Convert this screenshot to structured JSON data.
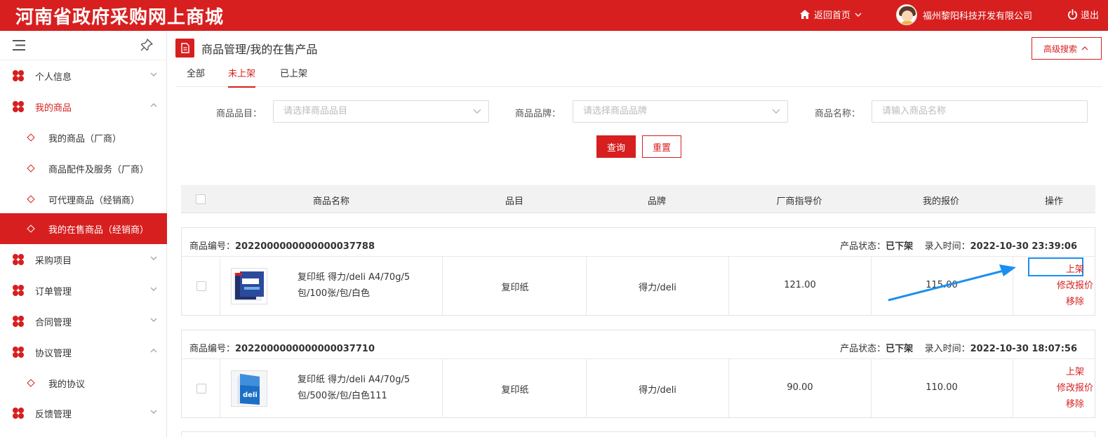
{
  "header": {
    "brand": "河南省政府采购网上商城",
    "home_label": "返回首页",
    "company": "福州黎阳科技开发有限公司",
    "logout_label": "退出"
  },
  "sidebar": {
    "items": [
      {
        "label": "个人信息",
        "type": "group"
      },
      {
        "label": "我的商品",
        "type": "group",
        "open": true
      },
      {
        "label": "我的商品（厂商）",
        "type": "sub"
      },
      {
        "label": "商品配件及服务（厂商）",
        "type": "sub"
      },
      {
        "label": "可代理商品（经销商）",
        "type": "sub"
      },
      {
        "label": "我的在售商品（经销商）",
        "type": "sub",
        "active": true
      },
      {
        "label": "采购项目",
        "type": "group"
      },
      {
        "label": "订单管理",
        "type": "group"
      },
      {
        "label": "合同管理",
        "type": "group"
      },
      {
        "label": "协议管理",
        "type": "group",
        "open": true
      },
      {
        "label": "我的协议",
        "type": "sub"
      },
      {
        "label": "反馈管理",
        "type": "group"
      }
    ]
  },
  "page": {
    "title": "商品管理/我的在售产品",
    "advanced_search": "高级搜索",
    "tabs": [
      {
        "label": "全部"
      },
      {
        "label": "未上架",
        "active": true
      },
      {
        "label": "已上架"
      }
    ]
  },
  "filters": {
    "category_label": "商品品目：",
    "category_placeholder": "请选择商品品目",
    "brand_label": "商品品牌：",
    "brand_placeholder": "请选择商品品牌",
    "name_label": "商品名称：",
    "name_placeholder": "请输入商品名称",
    "query_button": "查询",
    "reset_button": "重置"
  },
  "table": {
    "columns": [
      "商品名称",
      "品目",
      "品牌",
      "厂商指导价",
      "我的报价",
      "操作"
    ],
    "rows": [
      {
        "code_label": "商品编号：",
        "code": "2022000000000000037788",
        "status_label": "产品状态：",
        "status": "已下架",
        "time_label": "录入时间：",
        "time": "2022-10-30 23:39:06",
        "name_line1": "复印纸 得力/deli A4/70g/5",
        "name_line2": "包/100张/包/白色",
        "category": "复印纸",
        "brand": "得力/deli",
        "guide_price": "121.00",
        "my_price": "115.00",
        "actions": [
          "上架",
          "修改报价",
          "移除"
        ]
      },
      {
        "code_label": "商品编号：",
        "code": "2022000000000000037710",
        "status_label": "产品状态：",
        "status": "已下架",
        "time_label": "录入时间：",
        "time": "2022-10-30 18:07:56",
        "name_line1": "复印纸 得力/deli A4/70g/5",
        "name_line2": "包/500张/包/白色111",
        "category": "复印纸",
        "brand": "得力/deli",
        "guide_price": "90.00",
        "my_price": "110.00",
        "actions": [
          "上架",
          "修改报价",
          "移除"
        ]
      }
    ]
  },
  "colors": {
    "brand_red": "#d71f1f",
    "annotation_blue": "#1a8ff0"
  }
}
